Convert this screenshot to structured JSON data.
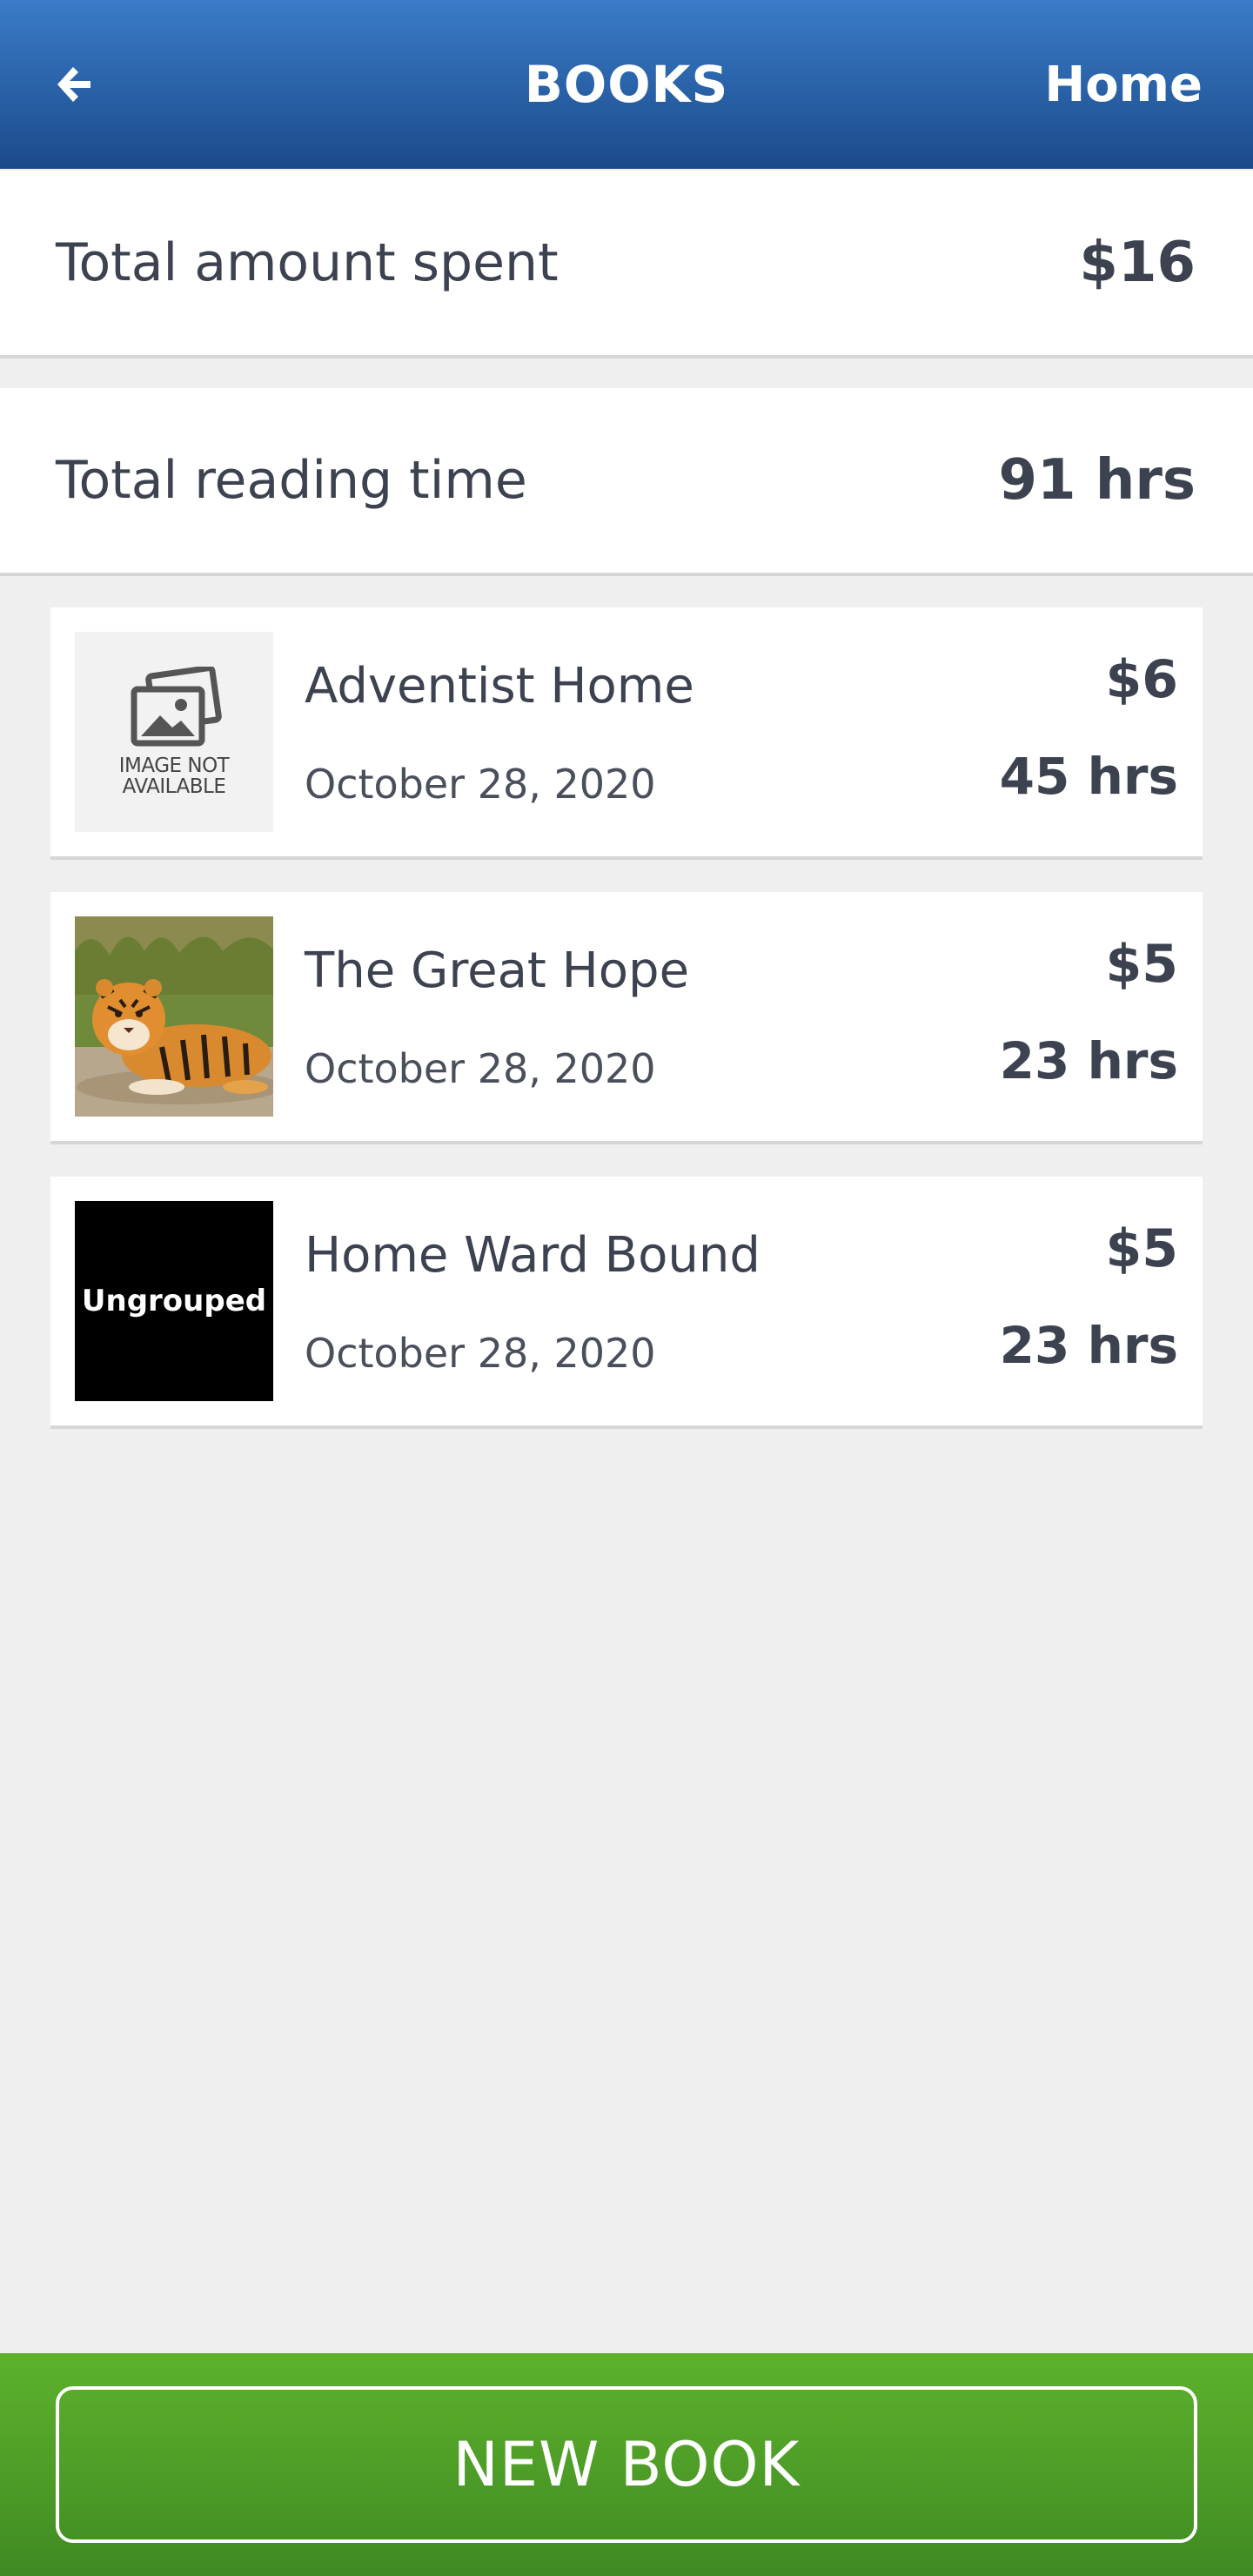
{
  "header": {
    "title": "BOOKS",
    "home_label": "Home",
    "back_icon": "arrow-left-icon"
  },
  "summary": {
    "spent_label": "Total amount spent",
    "spent_value": "$16",
    "time_label": "Total reading time",
    "time_value": "91 hrs"
  },
  "books": [
    {
      "title": "Adventist Home",
      "date": "October 28, 2020",
      "price": "$6",
      "hours": "45 hrs",
      "thumb_text": "IMAGE NOT AVAILABLE",
      "thumb_type": "image-not-available"
    },
    {
      "title": "The Great Hope",
      "date": "October 28, 2020",
      "price": "$5",
      "hours": "23 hrs",
      "thumb_type": "tiger-photo"
    },
    {
      "title": "Home Ward Bound",
      "date": "October 28, 2020",
      "price": "$5",
      "hours": "23 hrs",
      "thumb_text": "Ungrouped",
      "thumb_type": "text-cover"
    }
  ],
  "footer": {
    "new_book_label": "NEW BOOK"
  },
  "colors": {
    "header_top": "#3a7cc8",
    "header_bottom": "#1b4a8a",
    "footer_top": "#5eb22c",
    "footer_bottom": "#3f8a23",
    "background": "#efefef",
    "text": "#3d4250"
  }
}
